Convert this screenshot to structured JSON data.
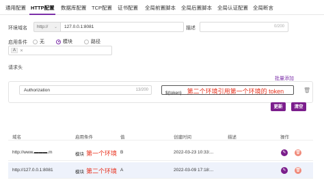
{
  "tabs": [
    {
      "label": "通用配置"
    },
    {
      "label": "HTTP配置"
    },
    {
      "label": "数据库配置"
    },
    {
      "label": "TCP配置"
    },
    {
      "label": "证书配置"
    },
    {
      "label": "全局前置脚本"
    },
    {
      "label": "全局后置脚本"
    },
    {
      "label": "全局认证配置"
    },
    {
      "label": "全局断言"
    }
  ],
  "form": {
    "env_domain_label": "环境域名",
    "protocol": "http://",
    "host": "127.0.0.1:8081",
    "desc_label": "描述",
    "desc_count": "0/200",
    "condition_label": "启用条件",
    "radio_none": "无",
    "radio_module": "模块",
    "radio_path": "路径",
    "env_tag": "A",
    "headers_label": "请求头",
    "bulk_add": "批量添加",
    "header_key": "Authorization",
    "header_key_count": "13/200",
    "header_value": "${token}",
    "header_annotation": "第二个环境引用第一个环境的 token",
    "update_button": "更新",
    "clear_button": "清空"
  },
  "table": {
    "headers": [
      "域名",
      "启用条件",
      "值",
      "创建时间",
      "描述",
      "操作"
    ],
    "rows": [
      {
        "domain": "http://www.▬▬▬.m",
        "condition": "模块",
        "annotation": "第一个环境",
        "value": "B",
        "created": "2022-03-23 10:33:..."
      },
      {
        "domain": "http://127.0.0.1:8081",
        "condition": "模块",
        "annotation": "第二个环境",
        "value": "A",
        "created": "2022-03-09 17:18:..."
      }
    ]
  },
  "colors": {
    "accent": "#7b1e8c",
    "annotation": "#e8321e",
    "selected_row": "#eef2fb"
  }
}
